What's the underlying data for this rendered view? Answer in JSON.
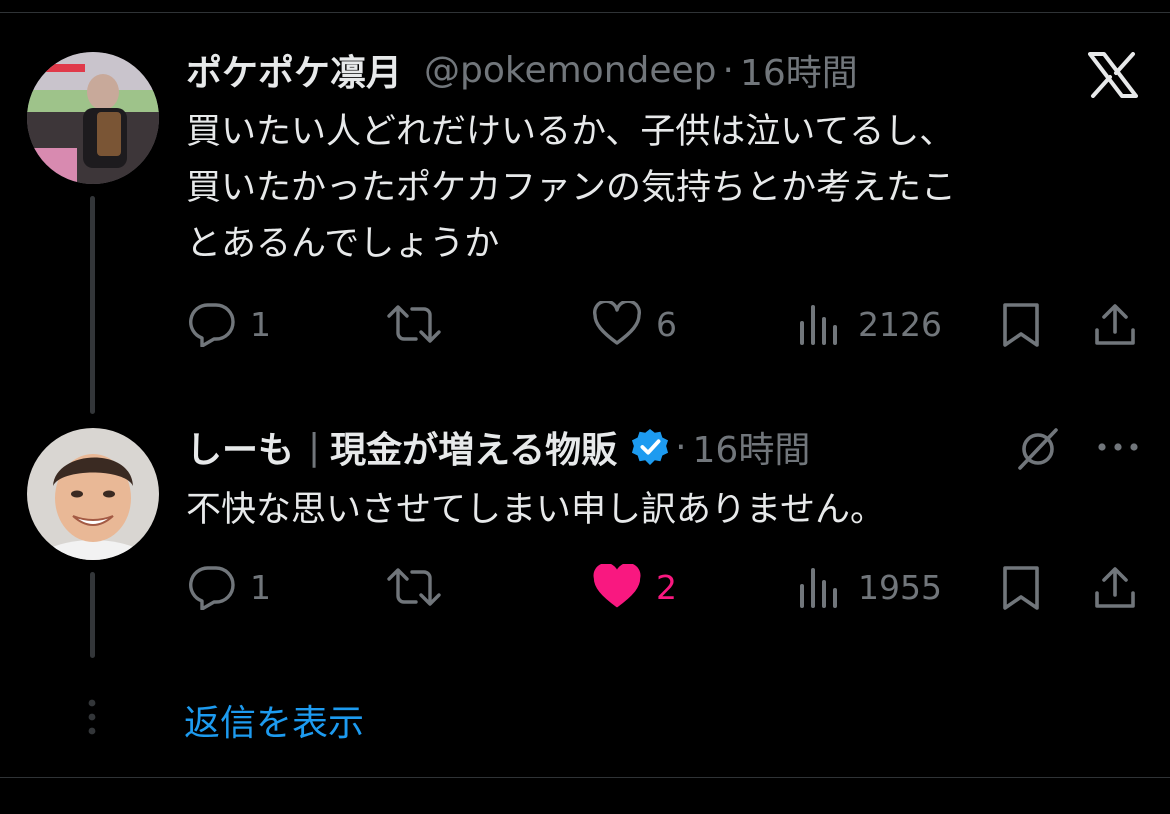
{
  "tweets": [
    {
      "display_name": "ポケポケ凛月",
      "handle": "@pokemondeep",
      "dot": "·",
      "time": "16時間",
      "text_lines": [
        "買いたい人どれだけいるか、子供は泣いてるし、",
        "買いたかったポケカファンの気持ちとか考えたこ",
        "とあるんでしょうか"
      ],
      "replies": "1",
      "likes": "6",
      "views": "2126"
    },
    {
      "display_name": "しーも",
      "separator": "|",
      "name_suffix": "現金が増える物販",
      "dot": "·",
      "time": "16時間",
      "text_lines": [
        "不快な思いさせてしまい申し訳ありません。"
      ],
      "replies": "1",
      "likes": "2",
      "views": "1955"
    }
  ],
  "show_replies": "返信を表示",
  "colors": {
    "background": "#000000",
    "text": "#e7e9ea",
    "muted": "#71767b",
    "link": "#1d9bf0",
    "like": "#f91880",
    "verified": "#1d9bf0"
  },
  "icons": [
    "x-logo-icon",
    "reply-icon",
    "retweet-icon",
    "heart-icon",
    "views-icon",
    "bookmark-icon",
    "share-icon",
    "grok-icon",
    "more-icon",
    "verified-badge-icon"
  ]
}
